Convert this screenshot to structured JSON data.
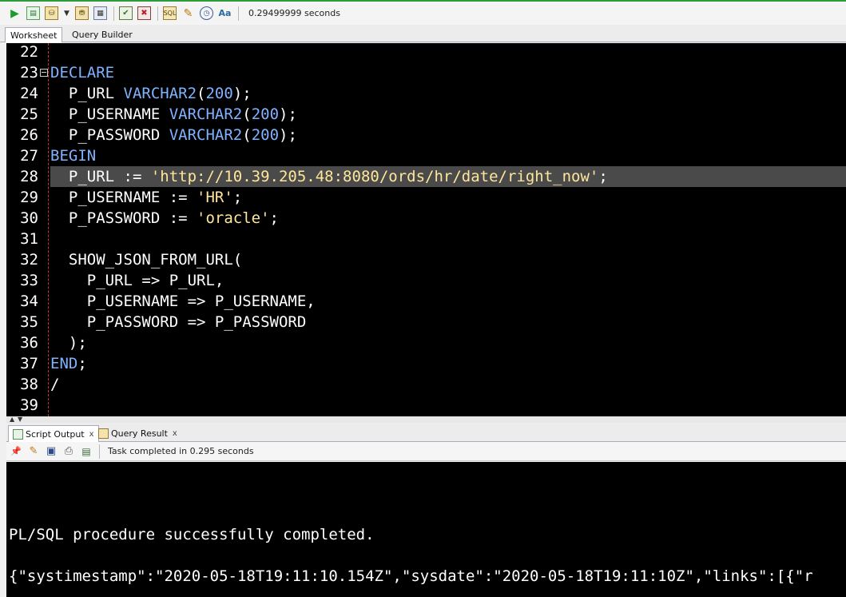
{
  "toolbar": {
    "icons": [
      "run-statement-icon",
      "run-script-icon",
      "commit-icon",
      "dropdown-icon",
      "rollback-icon",
      "explain-plan-icon",
      "autotrace-icon",
      "sql-tuning-icon",
      "clear-icon",
      "history-icon",
      "format-case-icon"
    ],
    "elapsed": "0.29499999 seconds"
  },
  "tabs": {
    "worksheet": "Worksheet",
    "query_builder": "Query Builder"
  },
  "editor": {
    "line_numbers": [
      "22",
      "23",
      "24",
      "25",
      "26",
      "27",
      "28",
      "29",
      "30",
      "31",
      "32",
      "33",
      "34",
      "35",
      "36",
      "37",
      "38",
      "39"
    ],
    "highlighted_line": "28"
  },
  "output_tabs": {
    "script_output": "Script Output",
    "query_result": "Query Result",
    "close": "x"
  },
  "output_toolbar": {
    "status": "Task completed in 0.295 seconds"
  },
  "output": {
    "line1": "PL/SQL procedure successfully completed.",
    "line2": "{\"systimestamp\":\"2020-05-18T19:11:10.154Z\",\"sysdate\":\"2020-05-18T19:11:10Z\",\"links\":[{\"r"
  },
  "colors": {
    "keyword": "#7fb2ff",
    "string": "#ffe69a",
    "text": "#ffffff",
    "editor_bg": "#000000",
    "highlight": "#4a4a4a"
  }
}
